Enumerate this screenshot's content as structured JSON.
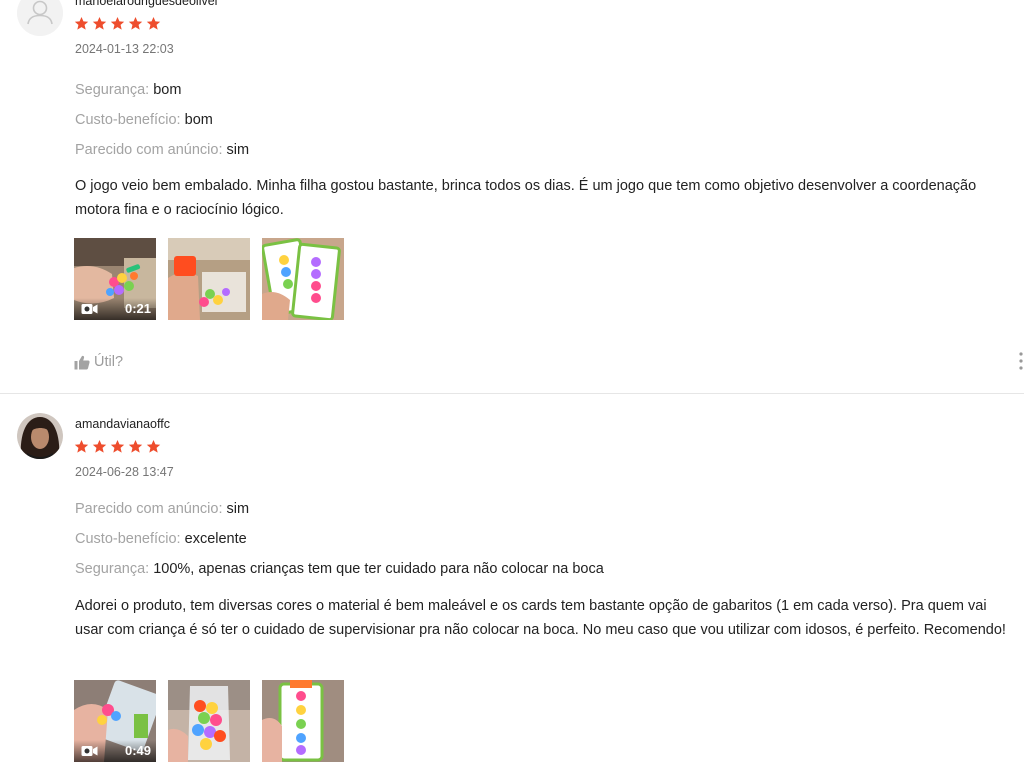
{
  "reviews": [
    {
      "username": "manoelarodriguesdeolivei",
      "rating": 5,
      "datetime": "2024-01-13 22:03",
      "attributes": [
        {
          "label": "Segurança:",
          "value": "bom"
        },
        {
          "label": "Custo-benefício:",
          "value": "bom"
        },
        {
          "label": "Parecido com anúncio:",
          "value": "sim"
        }
      ],
      "comment": "O jogo veio bem embalado. Minha filha gostou bastante, brinca todos os dias. É um jogo que tem como objetivo desenvolver a coordenação motora fina e o raciocínio lógico.",
      "video_duration": "0:21",
      "helpful_label": "Útil?",
      "avatar_icon": "default-user-avatar-icon"
    },
    {
      "username": "amandavianaoffc",
      "rating": 5,
      "datetime": "2024-06-28 13:47",
      "attributes": [
        {
          "label": "Parecido com anúncio:",
          "value": "sim"
        },
        {
          "label": "Custo-benefício:",
          "value": "excelente"
        },
        {
          "label": "Segurança:",
          "value": "100%, apenas crianças tem que ter cuidado para não colocar na boca"
        }
      ],
      "comment": "Adorei o produto, tem diversas cores o material é bem maleável e os cards tem bastante opção de gabaritos (1 em cada verso). Pra quem vai usar com criança é só ter o cuidado de supervisionar pra não colocar na boca. No meu caso que vou utilizar com idosos, é perfeito. Recomendo!",
      "video_duration": "0:49",
      "avatar_icon": "user-photo-avatar"
    }
  ],
  "colors": {
    "star": "#ee4d2d",
    "label": "#a3a3a3",
    "muted": "#767676"
  }
}
